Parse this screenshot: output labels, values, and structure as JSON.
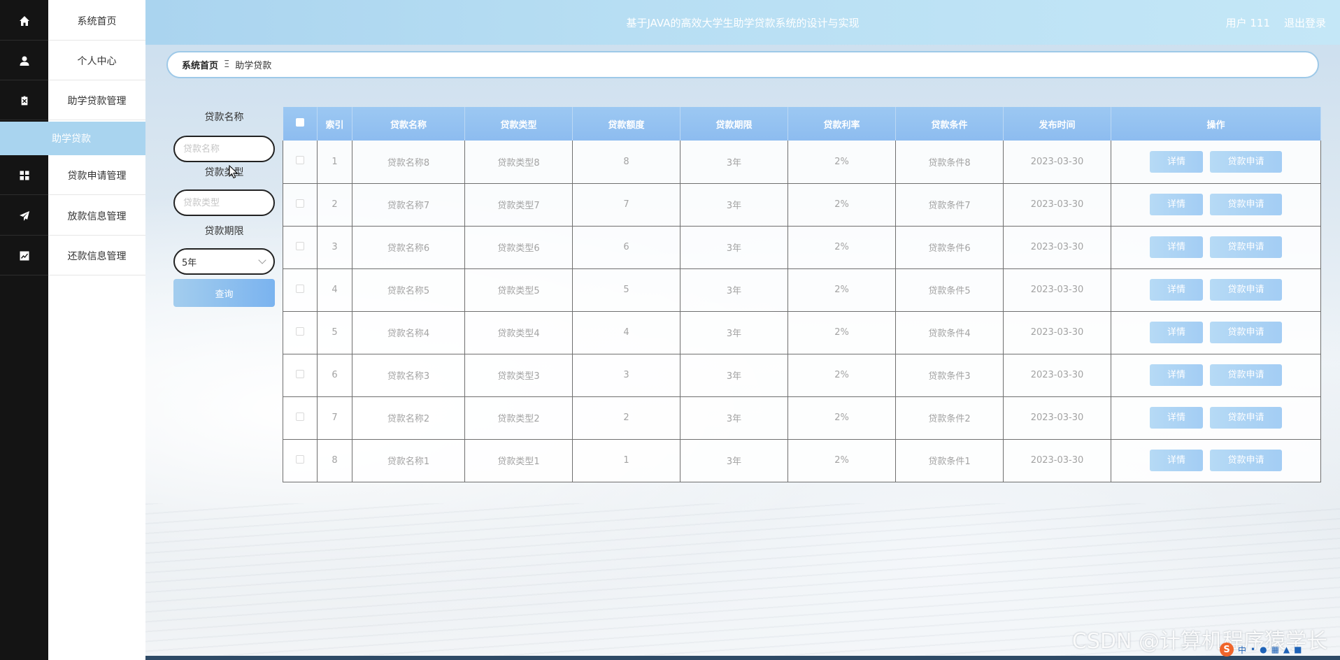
{
  "header": {
    "title": "基于JAVA的高效大学生助学贷款系统的设计与实现",
    "user": "用户 111",
    "logout": "退出登录"
  },
  "sidebar": {
    "items": [
      {
        "label": "系统首页",
        "icon": "home-icon"
      },
      {
        "label": "个人中心",
        "icon": "user-icon"
      },
      {
        "label": "助学贷款管理",
        "icon": "clipboard-icon"
      },
      {
        "label": "贷款申请管理",
        "icon": "grid-icon"
      },
      {
        "label": "放款信息管理",
        "icon": "send-icon"
      },
      {
        "label": "还款信息管理",
        "icon": "chart-icon"
      }
    ],
    "active_sub": "助学贷款"
  },
  "breadcrumb": {
    "home": "系统首页",
    "separator": "Ξ",
    "current": "助学贷款"
  },
  "search": {
    "name_label": "贷款名称",
    "name_placeholder": "贷款名称",
    "type_label": "贷款类型",
    "type_placeholder": "贷款类型",
    "period_label": "贷款期限",
    "period_value": "5年",
    "button": "查询"
  },
  "table": {
    "headers": [
      "索引",
      "贷款名称",
      "贷款类型",
      "贷款额度",
      "贷款期限",
      "贷款利率",
      "贷款条件",
      "发布时间",
      "操作"
    ],
    "rows": [
      {
        "index": "1",
        "name": "贷款名称8",
        "type": "贷款类型8",
        "amount": "8",
        "period": "3年",
        "rate": "2%",
        "condition": "贷款条件8",
        "date": "2023-03-30"
      },
      {
        "index": "2",
        "name": "贷款名称7",
        "type": "贷款类型7",
        "amount": "7",
        "period": "3年",
        "rate": "2%",
        "condition": "贷款条件7",
        "date": "2023-03-30"
      },
      {
        "index": "3",
        "name": "贷款名称6",
        "type": "贷款类型6",
        "amount": "6",
        "period": "3年",
        "rate": "2%",
        "condition": "贷款条件6",
        "date": "2023-03-30"
      },
      {
        "index": "4",
        "name": "贷款名称5",
        "type": "贷款类型5",
        "amount": "5",
        "period": "3年",
        "rate": "2%",
        "condition": "贷款条件5",
        "date": "2023-03-30"
      },
      {
        "index": "5",
        "name": "贷款名称4",
        "type": "贷款类型4",
        "amount": "4",
        "period": "3年",
        "rate": "2%",
        "condition": "贷款条件4",
        "date": "2023-03-30"
      },
      {
        "index": "6",
        "name": "贷款名称3",
        "type": "贷款类型3",
        "amount": "3",
        "period": "3年",
        "rate": "2%",
        "condition": "贷款条件3",
        "date": "2023-03-30"
      },
      {
        "index": "7",
        "name": "贷款名称2",
        "type": "贷款类型2",
        "amount": "2",
        "period": "3年",
        "rate": "2%",
        "condition": "贷款条件2",
        "date": "2023-03-30"
      },
      {
        "index": "8",
        "name": "贷款名称1",
        "type": "贷款类型1",
        "amount": "1",
        "period": "3年",
        "rate": "2%",
        "condition": "贷款条件1",
        "date": "2023-03-30"
      }
    ],
    "detail_label": "详情",
    "apply_label": "贷款申请"
  },
  "watermark": "CSDN @计算机程序猿学长",
  "tray": {
    "logo": "S",
    "ime_label": "中"
  },
  "colors": {
    "sidebar_dark": "#141414",
    "accent_blue": "#a9d4ef",
    "table_header": "#8dbcf0"
  }
}
